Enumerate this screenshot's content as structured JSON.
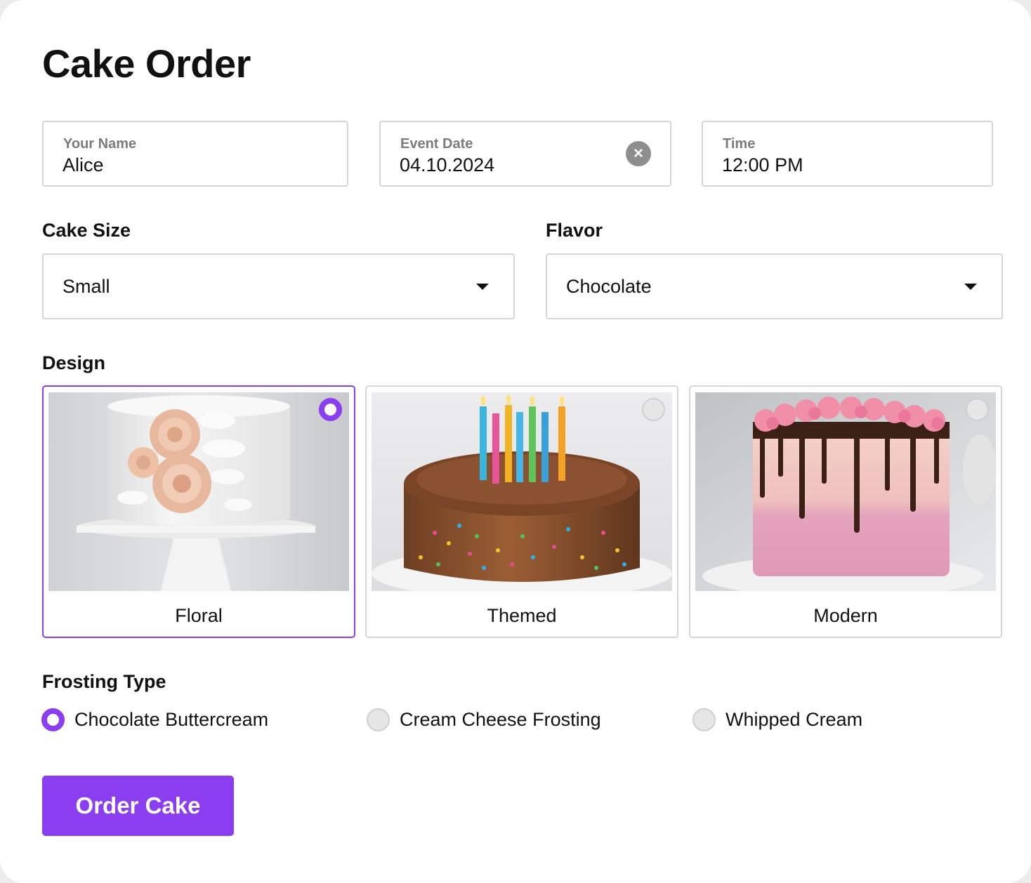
{
  "page": {
    "title": "Cake Order"
  },
  "fields": {
    "name": {
      "label": "Your Name",
      "value": "Alice"
    },
    "date": {
      "label": "Event Date",
      "value": "04.10.2024"
    },
    "time": {
      "label": "Time",
      "value": "12:00 PM"
    }
  },
  "cake_size": {
    "label": "Cake Size",
    "value": "Small"
  },
  "flavor": {
    "label": "Flavor",
    "value": "Chocolate"
  },
  "design": {
    "label": "Design",
    "selected": "Floral",
    "options": [
      {
        "label": "Floral",
        "image": "white cake with peach sugar roses on a stand",
        "selected": true
      },
      {
        "label": "Themed",
        "image": "chocolate cake with rainbow sprinkles and striped candles",
        "selected": false
      },
      {
        "label": "Modern",
        "image": "pink ombre cake with chocolate drip and piped rosettes",
        "selected": false
      }
    ]
  },
  "frosting": {
    "label": "Frosting Type",
    "options": [
      {
        "label": "Chocolate Buttercream",
        "selected": true
      },
      {
        "label": "Cream Cheese Frosting",
        "selected": false
      },
      {
        "label": "Whipped Cream",
        "selected": false
      }
    ]
  },
  "submit": {
    "label": "Order Cake"
  },
  "icons": {
    "clear": "close-circle-icon",
    "caret": "caret-down-icon",
    "radio": "radio-icon"
  },
  "colors": {
    "accent": "#8b3df0",
    "border": "#d6d6d6",
    "muted_label": "#7b7b7b",
    "background": "#ffffff"
  }
}
